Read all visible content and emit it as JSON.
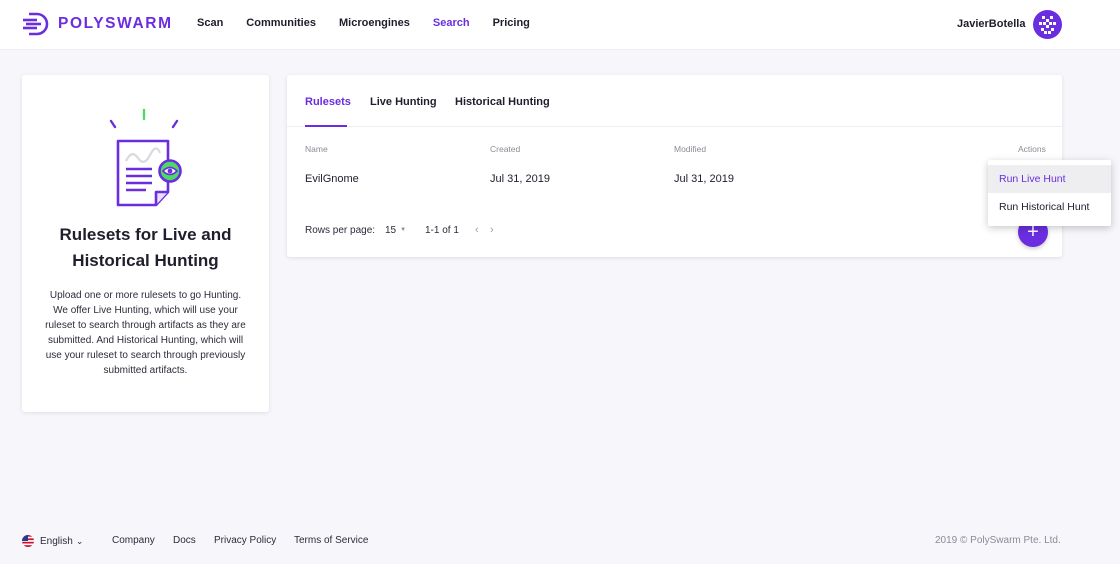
{
  "header": {
    "logo_text": "POLYSWARM",
    "nav": [
      "Scan",
      "Communities",
      "Microengines",
      "Search",
      "Pricing"
    ],
    "active_nav": "Search",
    "username": "JavierBotella"
  },
  "info_card": {
    "title_line1": "Rulesets for Live and",
    "title_line2": "Historical Hunting",
    "description": "Upload one or more rulesets to go Hunting. We offer Live Hunting, which will use your ruleset to search through artifacts as they are submitted. And Historical Hunting, which will use your ruleset to search through previously submitted artifacts."
  },
  "tabs": [
    "Rulesets",
    "Live Hunting",
    "Historical Hunting"
  ],
  "table": {
    "columns": [
      "Name",
      "Created",
      "Modified",
      "Actions"
    ],
    "rows": [
      {
        "name": "EvilGnome",
        "created": "Jul 31, 2019",
        "modified": "Jul 31, 2019"
      }
    ],
    "rows_per_page_label": "Rows per page:",
    "rows_per_page": "15",
    "page_range": "1-1 of 1",
    "prev_icon": "chevron-left",
    "next_icon": "chevron-right"
  },
  "fab_label": "+",
  "action_menu": {
    "items": [
      "Run Live Hunt",
      "Run Historical Hunt"
    ],
    "hovered": "Run Live Hunt"
  },
  "footer": {
    "language": "English",
    "links": [
      "Company",
      "Docs",
      "Privacy Policy",
      "Terms of Service"
    ],
    "copyright": "2019 © PolySwarm Pte. Ltd."
  },
  "colors": {
    "brand": "#6a2ee0",
    "illustration_accent": "#4cd964",
    "background": "#f7f6fb"
  }
}
